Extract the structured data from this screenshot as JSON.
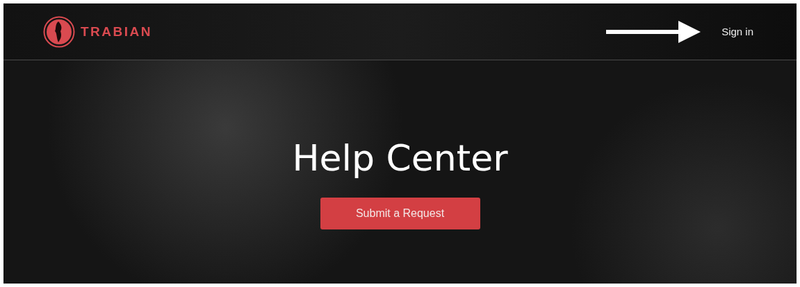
{
  "header": {
    "logo_text": "TRABIAN",
    "sign_in": "Sign in"
  },
  "hero": {
    "title": "Help Center",
    "button": "Submit a Request"
  }
}
